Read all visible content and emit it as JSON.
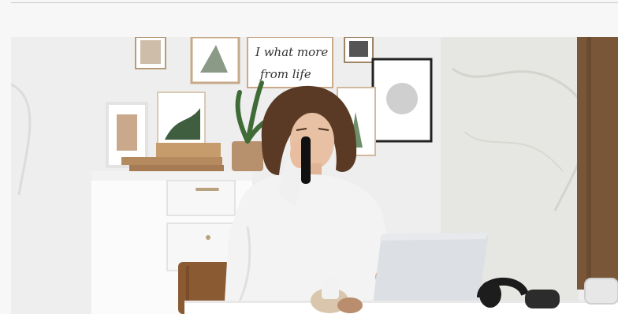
{
  "hero_image": {
    "alt": "",
    "scene_text": {
      "poster_line_1": "I what more",
      "poster_line_2": "from life"
    }
  },
  "colors": {
    "page_background": "#f7f7f7",
    "rule": "#c9c9c9",
    "wall": "#efefef",
    "wood": "#7a5638",
    "sweater": "#f3f3f3",
    "hair": "#5a3a24",
    "laptop": "#dcdfe3"
  }
}
